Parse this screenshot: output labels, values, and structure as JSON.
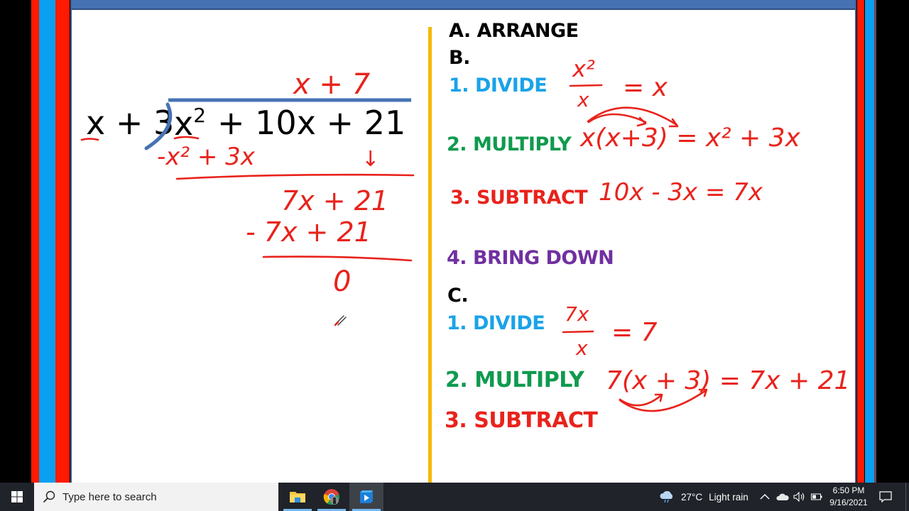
{
  "slide": {
    "divisor": "x + 3",
    "dividend_x": "x",
    "dividend_exp": "2",
    "dividend_rest": "+ 10x + 21",
    "handwritten": {
      "quotient": "x + 7",
      "first_product": "-x² + 3x",
      "bring_down_arrow": "↓",
      "first_remainder": "7x + 21",
      "second_product": "- 7x + 21",
      "final_remainder": "0"
    },
    "steps": {
      "a_label": "A. ARRANGE",
      "b_label": "B.",
      "b_divide": "1. DIVIDE",
      "b_multiply": "2. MULTIPLY",
      "b_subtract": "3. SUBTRACT",
      "b_bring_down": "4. BRING DOWN",
      "c_label": "C.",
      "c_divide": "1. DIVIDE",
      "c_multiply": "2. MULTIPLY",
      "c_subtract": "3. SUBTRACT"
    },
    "work": {
      "b_divide_num": "x²",
      "b_divide_den": "x",
      "b_divide_result": "= x",
      "b_multiply": "x(x+3) = x² + 3x",
      "b_subtract": "10x - 3x = 7x",
      "c_divide_num": "7x",
      "c_divide_den": "x",
      "c_divide_result": "= 7",
      "c_multiply": "7(x + 3) = 7x + 21"
    },
    "colors": {
      "divide": "#1aa3e8",
      "multiply": "#0f9a4e",
      "subtract": "#e8231c",
      "bring_down": "#7030a0",
      "ink": "#e8231c",
      "divider": "#f5b800",
      "bracket": "#4672b4"
    }
  },
  "taskbar": {
    "search_placeholder": "Type here to search",
    "apps": [
      {
        "name": "File Explorer",
        "icon": "folder-icon"
      },
      {
        "name": "Google Chrome",
        "icon": "chrome-icon"
      },
      {
        "name": "Video Player",
        "icon": "video-player-icon"
      }
    ],
    "weather_temp": "27°C",
    "weather_desc": "Light rain",
    "time": "6:50 PM",
    "date": "9/16/2021"
  }
}
